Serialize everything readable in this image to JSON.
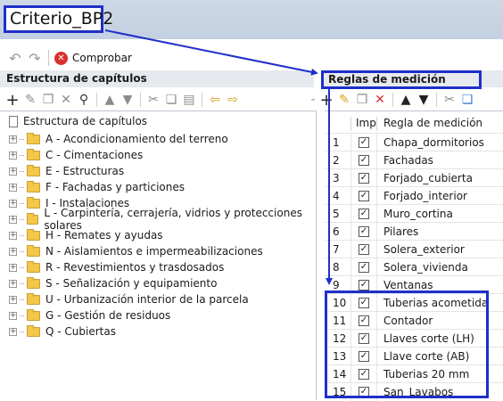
{
  "title": "Criterio_BP2",
  "command_bar": {
    "check_label": "Comprobar",
    "icons": [
      "undo-icon",
      "redo-icon",
      "error-icon"
    ]
  },
  "left_panel": {
    "header": "Estructura de capítulos",
    "root": "Estructura de capítulos",
    "items": [
      {
        "label": "A - Acondicionamiento del terreno"
      },
      {
        "label": "C - Cimentaciones"
      },
      {
        "label": "E - Estructuras"
      },
      {
        "label": "F - Fachadas y particiones"
      },
      {
        "label": "I - Instalaciones"
      },
      {
        "label": "L - Carpintería, cerrajería, vidrios y protecciones solares"
      },
      {
        "label": "H - Remates y ayudas"
      },
      {
        "label": "N - Aislamientos e impermeabilizaciones"
      },
      {
        "label": "R - Revestimientos y trasdosados"
      },
      {
        "label": "S - Señalización y equipamiento"
      },
      {
        "label": "U - Urbanización interior de la parcela"
      },
      {
        "label": "G - Gestión de residuos"
      },
      {
        "label": "Q - Cubiertas"
      }
    ]
  },
  "right_panel": {
    "header": "Reglas de medición",
    "columns": {
      "imp": "Imp",
      "regla": "Regla de medición"
    },
    "rows": [
      {
        "num": "1",
        "checked": true,
        "name": "Chapa_dormitorios"
      },
      {
        "num": "2",
        "checked": true,
        "name": "Fachadas"
      },
      {
        "num": "3",
        "checked": true,
        "name": "Forjado_cubierta"
      },
      {
        "num": "4",
        "checked": true,
        "name": "Forjado_interior"
      },
      {
        "num": "5",
        "checked": true,
        "name": "Muro_cortina"
      },
      {
        "num": "6",
        "checked": true,
        "name": "Pilares"
      },
      {
        "num": "7",
        "checked": true,
        "name": "Solera_exterior"
      },
      {
        "num": "8",
        "checked": true,
        "name": "Solera_vivienda"
      },
      {
        "num": "9",
        "checked": true,
        "name": "Ventanas"
      },
      {
        "num": "10",
        "checked": true,
        "name": "Tuberias acometida"
      },
      {
        "num": "11",
        "checked": true,
        "name": "Contador"
      },
      {
        "num": "12",
        "checked": true,
        "name": "Llaves corte (LH)"
      },
      {
        "num": "13",
        "checked": true,
        "name": "Llave corte (AB)"
      },
      {
        "num": "14",
        "checked": true,
        "name": "Tuberias 20 mm"
      },
      {
        "num": "15",
        "checked": true,
        "name": "San_Lavabos"
      }
    ]
  },
  "colors": {
    "annotation": "#1f2fc9",
    "header_bg": "#e6e9ee",
    "title_bg": "#c7d3e3",
    "folder": "#f3c84a"
  }
}
